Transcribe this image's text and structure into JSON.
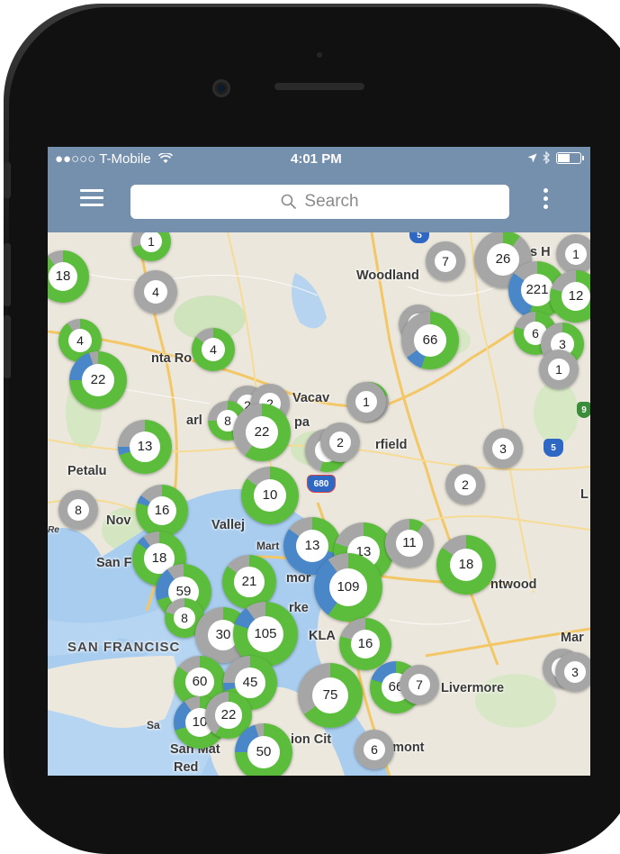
{
  "status_bar": {
    "carrier": "●●○○○ T-Mobile",
    "wifi_icon": "wifi-icon",
    "time": "4:01 PM",
    "location_icon": "location-arrow-icon",
    "bluetooth_icon": "bluetooth-icon",
    "battery_icon": "battery-icon"
  },
  "nav": {
    "menu_icon": "hamburger-icon",
    "search_placeholder": "Search",
    "search_icon": "magnifier-icon",
    "more_icon": "vertical-dots-icon"
  },
  "colors": {
    "available": "#5cbd3c",
    "in_use": "#4a87c9",
    "unknown": "#a6a6a6",
    "nav": "#7590ad"
  },
  "places": [
    "Woodland",
    "nta Ro",
    "Vacav",
    "rfield",
    "Petalu",
    "pa",
    "arl",
    "Nov",
    "Vallej",
    "Mart",
    "San F",
    "mor",
    "rke",
    "KLA",
    "ntwood",
    "SAN FRANCISC",
    "Livermore",
    "ion Cit",
    "emont",
    "San Mat",
    "Sa",
    "Red",
    "s H",
    "Mar",
    "L",
    "Re"
  ],
  "highway_shields": [
    {
      "label": "5"
    },
    {
      "label": "680"
    },
    {
      "label": "5"
    },
    {
      "label": "9"
    }
  ],
  "clusters": [
    {
      "label": "1"
    },
    {
      "label": "18"
    },
    {
      "label": "4"
    },
    {
      "label": "4"
    },
    {
      "label": "22"
    },
    {
      "label": "4"
    },
    {
      "label": "1"
    },
    {
      "label": "2"
    },
    {
      "label": "2"
    },
    {
      "label": "8"
    },
    {
      "label": "22"
    },
    {
      "label": "13"
    },
    {
      "label": "1"
    },
    {
      "label": "66"
    },
    {
      "label": "1"
    },
    {
      "label": "6"
    },
    {
      "label": "2"
    },
    {
      "label": "10"
    },
    {
      "label": "16"
    },
    {
      "label": "8"
    },
    {
      "label": "18"
    },
    {
      "label": "13"
    },
    {
      "label": "13"
    },
    {
      "label": "11"
    },
    {
      "label": "18"
    },
    {
      "label": "2"
    },
    {
      "label": "3"
    },
    {
      "label": "7"
    },
    {
      "label": "26"
    },
    {
      "label": "1"
    },
    {
      "label": "221"
    },
    {
      "label": "12"
    },
    {
      "label": "6"
    },
    {
      "label": "3"
    },
    {
      "label": "1"
    },
    {
      "label": "21"
    },
    {
      "label": "109"
    },
    {
      "label": "59"
    },
    {
      "label": "8"
    },
    {
      "label": "30"
    },
    {
      "label": "105"
    },
    {
      "label": "16"
    },
    {
      "label": "60"
    },
    {
      "label": "45"
    },
    {
      "label": "75"
    },
    {
      "label": "66"
    },
    {
      "label": "7"
    },
    {
      "label": "10"
    },
    {
      "label": "22"
    },
    {
      "label": "50"
    },
    {
      "label": "6"
    },
    {
      "label": "3"
    },
    {
      "label": "3"
    }
  ]
}
